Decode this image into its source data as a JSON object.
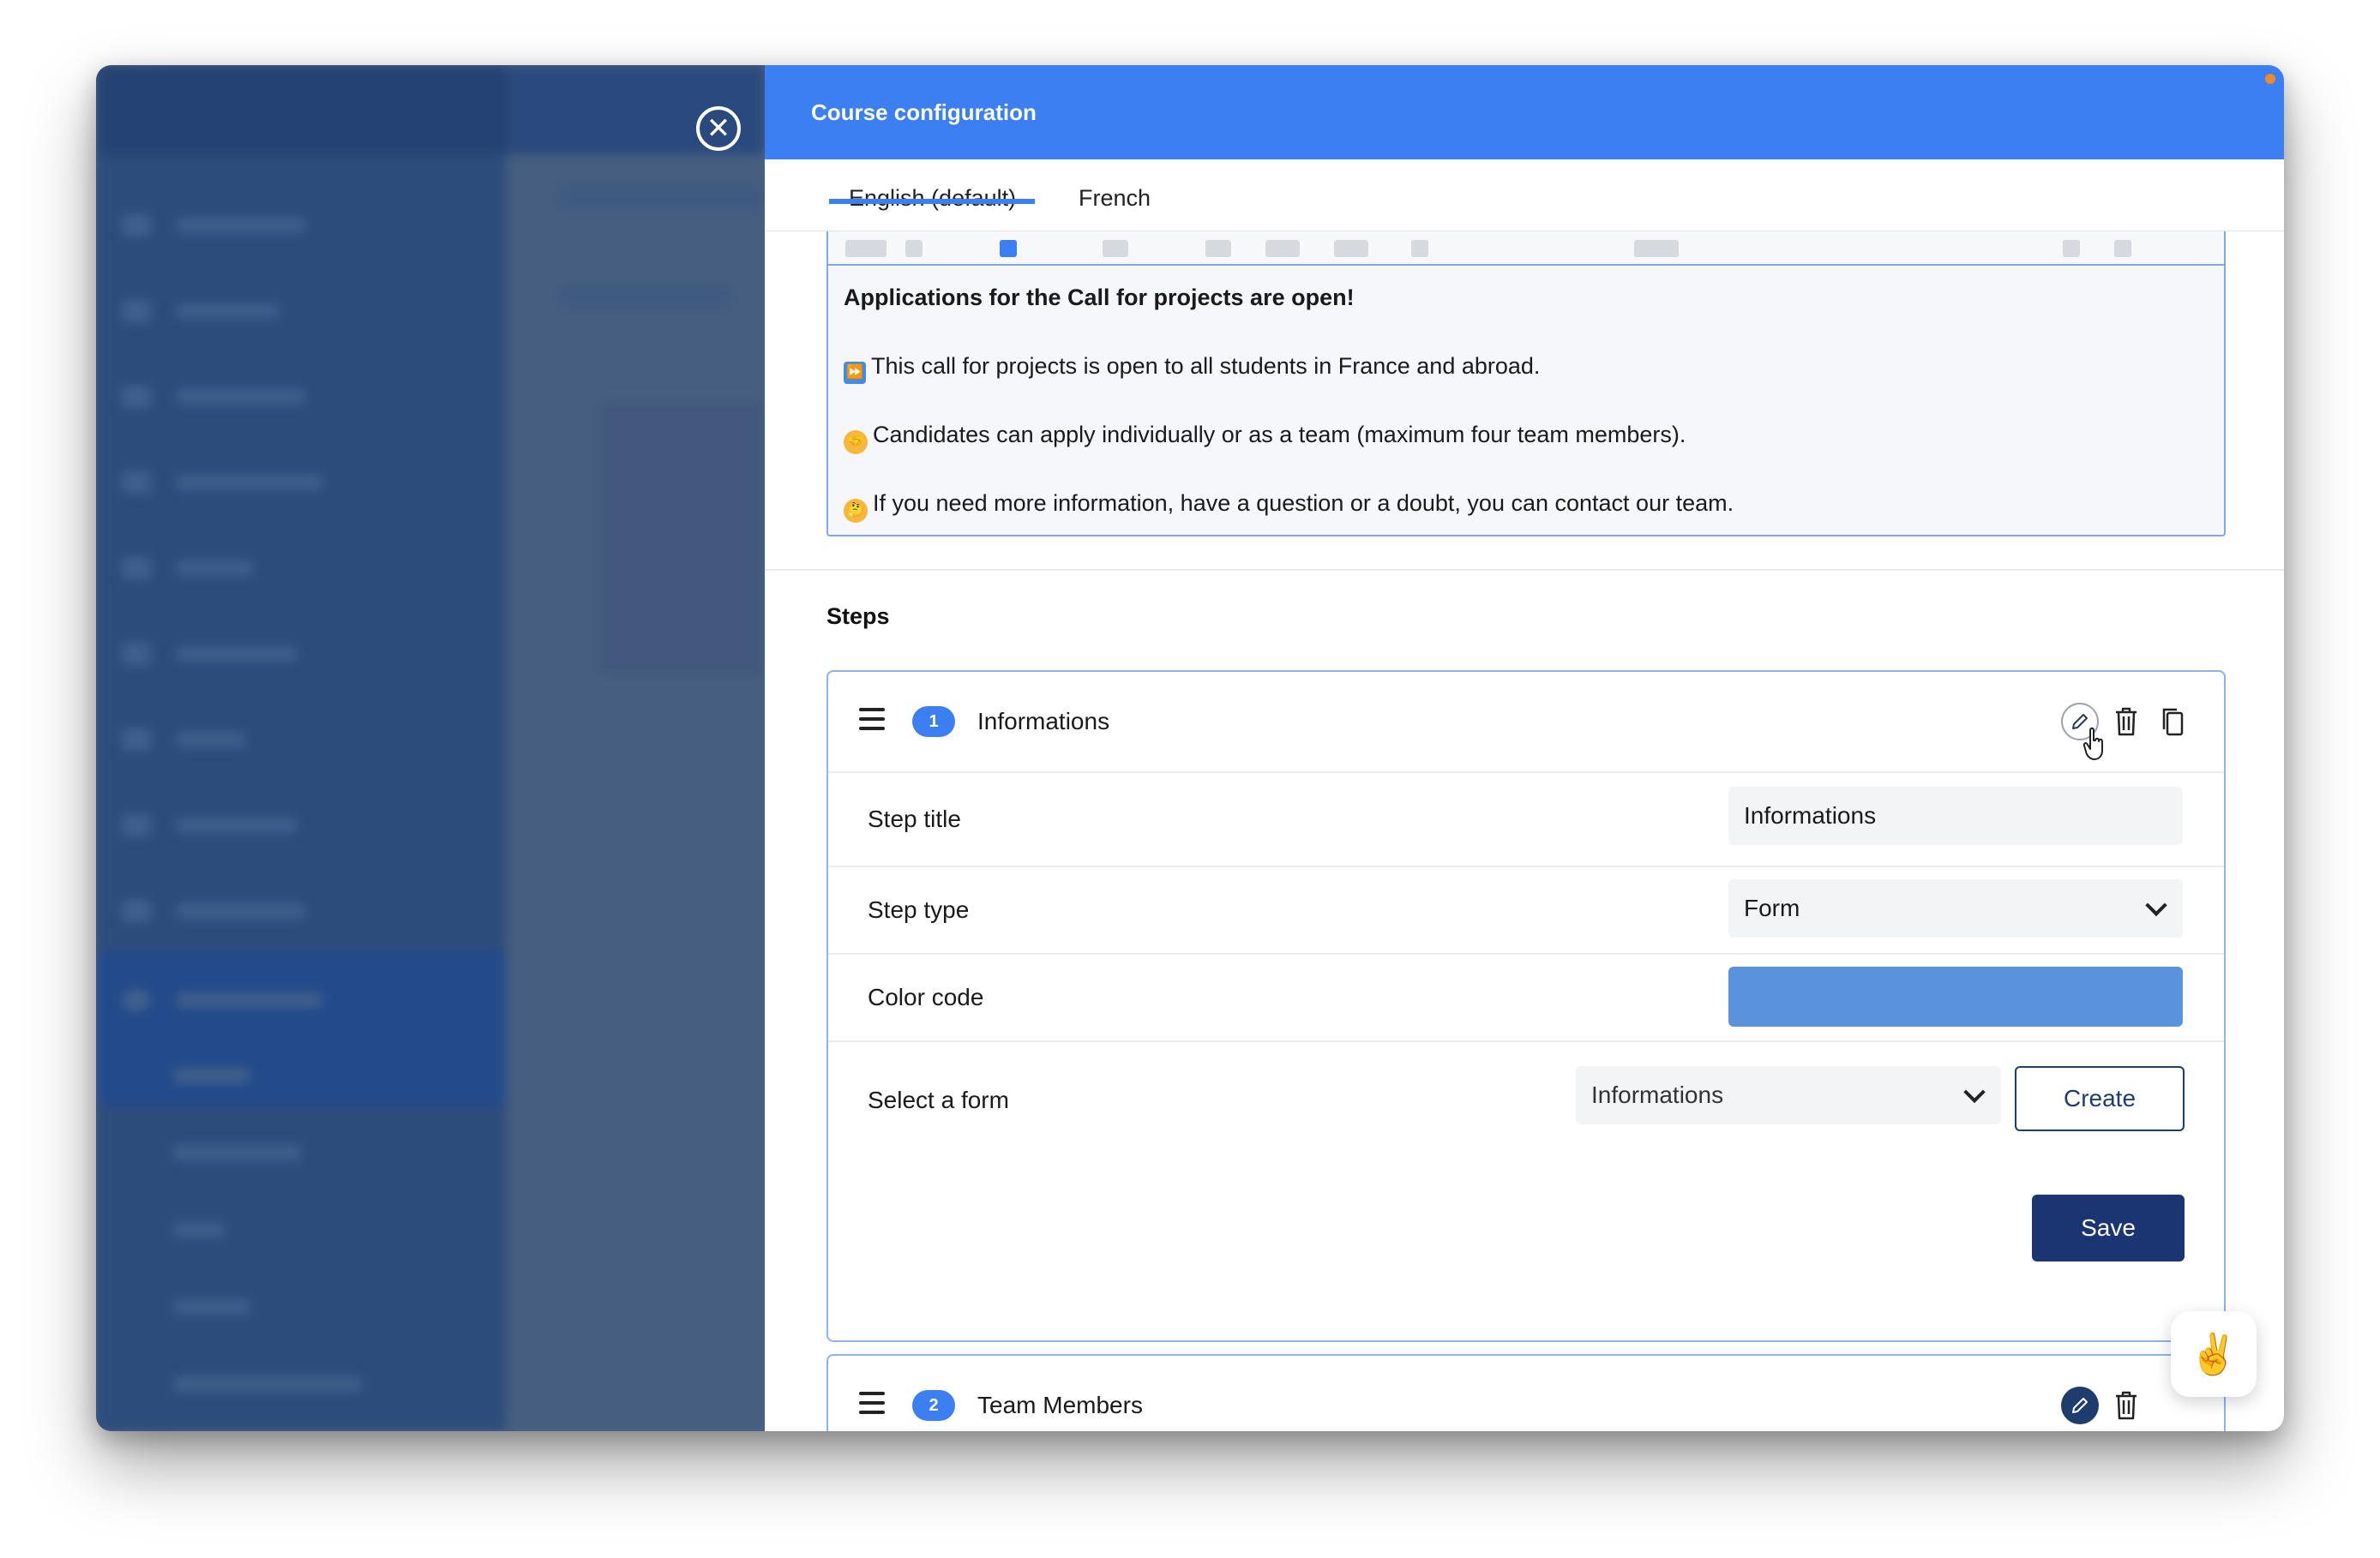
{
  "panel": {
    "title": "Course configuration",
    "tabs": [
      {
        "label": "English (default)",
        "active": true
      },
      {
        "label": "French",
        "active": false
      }
    ]
  },
  "editor": {
    "heading": "Applications for the Call for projects are open!",
    "lines": [
      {
        "emoji": "fast-forward-emoji",
        "text": "This call for projects is open to all students in France and abroad."
      },
      {
        "emoji": "handshake-emoji",
        "text": "Candidates can apply individually or as a team (maximum four team members)."
      },
      {
        "emoji": "thinking-face-emoji",
        "text": "If you need more information, have a question or a doubt, you can contact our team."
      }
    ]
  },
  "steps": {
    "title": "Steps",
    "items": [
      {
        "number": "1",
        "name": "Informations",
        "expanded": true,
        "fields": {
          "step_title_label": "Step title",
          "step_title_value": "Informations",
          "step_type_label": "Step type",
          "step_type_value": "Form",
          "color_code_label": "Color code",
          "color_code_value": "#5b92dd",
          "select_form_label": "Select a form",
          "select_form_value": "Informations",
          "create_label": "Create",
          "save_label": "Save"
        }
      },
      {
        "number": "2",
        "name": "Team Members",
        "expanded": false
      }
    ]
  },
  "floating": {
    "icon": "victory-hand-emoji"
  },
  "colors": {
    "accent": "#3b7ff2",
    "primary_dark": "#1b3573",
    "card_border": "#8fb1ee",
    "overlay": "#4a6485"
  }
}
